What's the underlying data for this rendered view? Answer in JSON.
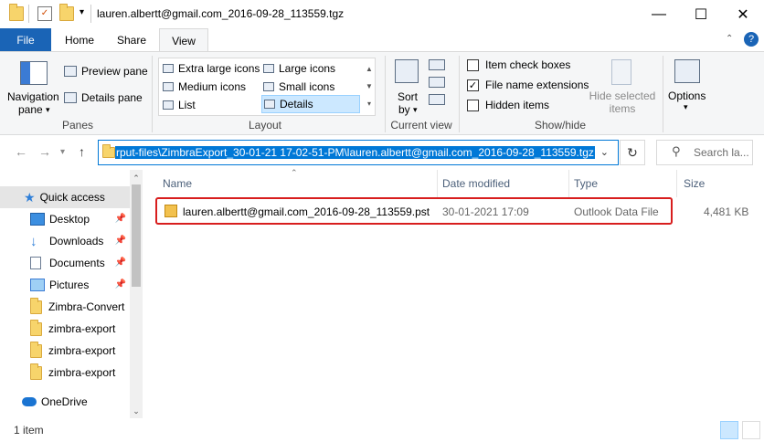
{
  "window": {
    "title": "lauren.albertt@gmail.com_2016-09-28_113559.tgz",
    "minimize_glyph": "—",
    "maximize_glyph": "☐",
    "close_glyph": "✕"
  },
  "tabs": [
    {
      "label": "File"
    },
    {
      "label": "Home"
    },
    {
      "label": "Share"
    },
    {
      "label": "View"
    }
  ],
  "ribbon": {
    "panes": {
      "navigation_pane": "Navigation",
      "navigation_pane_2": "pane",
      "preview_pane": "Preview pane",
      "details_pane": "Details pane",
      "group_label": "Panes"
    },
    "layout": {
      "items": [
        "Extra large icons",
        "Large icons",
        "Medium icons",
        "Small icons",
        "List",
        "Details"
      ],
      "group_label": "Layout"
    },
    "current_view": {
      "sort_by": "Sort",
      "sort_by_2": "by",
      "group_label": "Current view"
    },
    "show_hide": {
      "item_check_boxes": "Item check boxes",
      "item_check_boxes_checked": false,
      "file_name_extensions": "File name extensions",
      "file_name_extensions_checked": true,
      "hidden_items": "Hidden items",
      "hidden_items_checked": false,
      "hide_selected": "Hide selected",
      "hide_selected_2": "items",
      "group_label": "Show/hide"
    },
    "options": "Options"
  },
  "address": {
    "path": "rput-files\\ZimbraExport_30-01-21 17-02-51-PM\\lauren.albertt@gmail.com_2016-09-28_113559.tgz",
    "search_placeholder": "Search la..."
  },
  "nav": {
    "items": [
      {
        "label": "Quick access",
        "icon": "star-icon",
        "pinned": false
      },
      {
        "label": "Desktop",
        "icon": "desktop-icon",
        "pinned": true
      },
      {
        "label": "Downloads",
        "icon": "download-icon",
        "pinned": true
      },
      {
        "label": "Documents",
        "icon": "documents-icon",
        "pinned": true
      },
      {
        "label": "Pictures",
        "icon": "pictures-icon",
        "pinned": true
      },
      {
        "label": "Zimbra-Convert",
        "icon": "folder-icon",
        "pinned": false
      },
      {
        "label": "zimbra-export",
        "icon": "folder-icon",
        "pinned": false
      },
      {
        "label": "zimbra-export",
        "icon": "folder-icon",
        "pinned": false
      },
      {
        "label": "zimbra-export",
        "icon": "folder-icon",
        "pinned": false
      },
      {
        "label": "OneDrive",
        "icon": "onedrive-icon",
        "pinned": false
      }
    ]
  },
  "columns": {
    "name": "Name",
    "date_modified": "Date modified",
    "type": "Type",
    "size": "Size"
  },
  "files": [
    {
      "name": "lauren.albertt@gmail.com_2016-09-28_113559.pst",
      "date_modified": "30-01-2021 17:09",
      "type": "Outlook Data File",
      "size": "4,481 KB"
    }
  ],
  "status": {
    "item_count": "1 item"
  },
  "colors": {
    "accent": "#0078d7",
    "file_tab": "#1a64b6",
    "highlight_border": "#d81e1e"
  }
}
